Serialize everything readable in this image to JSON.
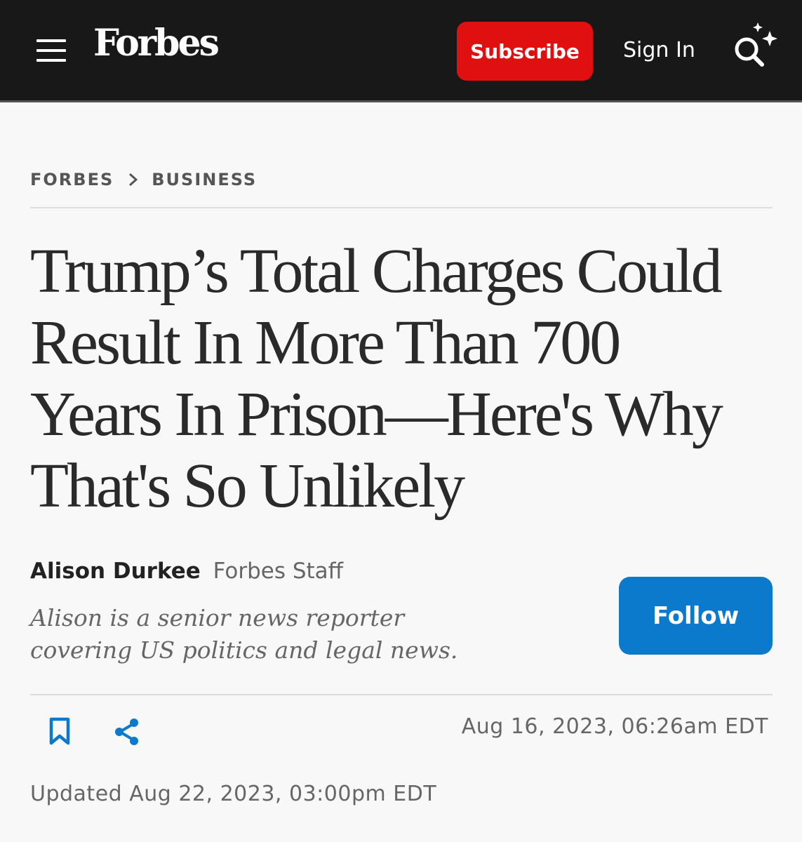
{
  "header": {
    "logo": "Forbes",
    "subscribe_label": "Subscribe",
    "signin_label": "Sign In",
    "menu_icon": "hamburger-menu-icon",
    "search_icon": "ai-search-icon"
  },
  "breadcrumb": {
    "items": [
      "FORBES",
      "BUSINESS"
    ]
  },
  "article": {
    "headline_lines": [
      "Trump’s Total Charges Could",
      "Result In More Than 700",
      "Years In Prison—Here's Why",
      "That's So Unlikely"
    ],
    "author_name": "Alison Durkee",
    "author_role": "Forbes Staff",
    "author_bio_lines": [
      "Alison is a senior news reporter",
      "covering US politics and legal news."
    ],
    "follow_label": "Follow",
    "published": "Aug 16, 2023, 06:26am EDT",
    "updated": "Updated Aug 22, 2023, 03:00pm EDT"
  },
  "colors": {
    "header_bg": "#181818",
    "subscribe_bg": "#e01010",
    "follow_bg": "#0b7acd",
    "icon_blue": "#0b7acd"
  }
}
